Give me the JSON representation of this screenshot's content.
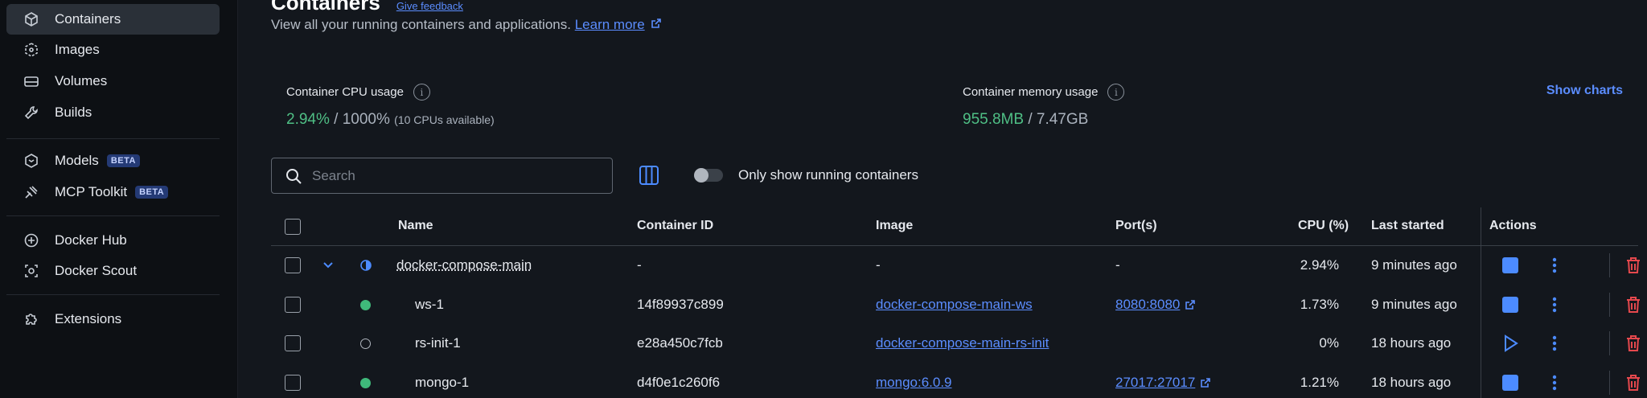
{
  "sidebar": {
    "items": [
      {
        "label": "Containers",
        "icon": "cube-icon"
      },
      {
        "label": "Images",
        "icon": "images-icon"
      },
      {
        "label": "Volumes",
        "icon": "volume-icon"
      },
      {
        "label": "Builds",
        "icon": "wrench-icon"
      },
      {
        "label": "Models",
        "icon": "models-icon",
        "badge": "BETA"
      },
      {
        "label": "MCP Toolkit",
        "icon": "toolkit-icon",
        "badge": "BETA"
      },
      {
        "label": "Docker Hub",
        "icon": "hub-icon"
      },
      {
        "label": "Docker Scout",
        "icon": "scout-icon"
      },
      {
        "label": "Extensions",
        "icon": "puzzle-icon"
      }
    ]
  },
  "header": {
    "title": "Containers",
    "feedback": "Give feedback",
    "subtitle": "View all your running containers and applications.",
    "learn_more": "Learn more"
  },
  "stats": {
    "cpu_label": "Container CPU usage",
    "cpu_used": "2.94%",
    "cpu_total": "/ 1000%",
    "cpu_note": "(10 CPUs available)",
    "mem_label": "Container memory usage",
    "mem_used": "955.8MB",
    "mem_total": "/ 7.47GB",
    "show_charts": "Show charts"
  },
  "toolbar": {
    "search_placeholder": "Search",
    "toggle_label": "Only show running containers"
  },
  "table": {
    "headers": {
      "name": "Name",
      "container_id": "Container ID",
      "image": "Image",
      "ports": "Port(s)",
      "cpu": "CPU (%)",
      "last_started": "Last started",
      "actions": "Actions"
    },
    "rows": [
      {
        "name": "docker-compose-main",
        "container_id": "-",
        "image": "-",
        "ports": "-",
        "cpu": "2.94%",
        "last_started": "9 minutes ago",
        "status": "partial"
      },
      {
        "name": "ws-1",
        "container_id": "14f89937c899",
        "image": "docker-compose-main-ws",
        "ports": "8080:8080",
        "cpu": "1.73%",
        "last_started": "9 minutes ago",
        "status": "running"
      },
      {
        "name": "rs-init-1",
        "container_id": "e28a450c7fcb",
        "image": "docker-compose-main-rs-init",
        "ports": "",
        "cpu": "0%",
        "last_started": "18 hours ago",
        "status": "stopped"
      },
      {
        "name": "mongo-1",
        "container_id": "d4f0e1c260f6",
        "image": "mongo:6.0.9",
        "ports": "27017:27017",
        "cpu": "1.21%",
        "last_started": "18 hours ago",
        "status": "running"
      }
    ]
  },
  "colors": {
    "accent": "#4c8bff",
    "running": "#3fb97a",
    "delete": "#e5484d"
  }
}
